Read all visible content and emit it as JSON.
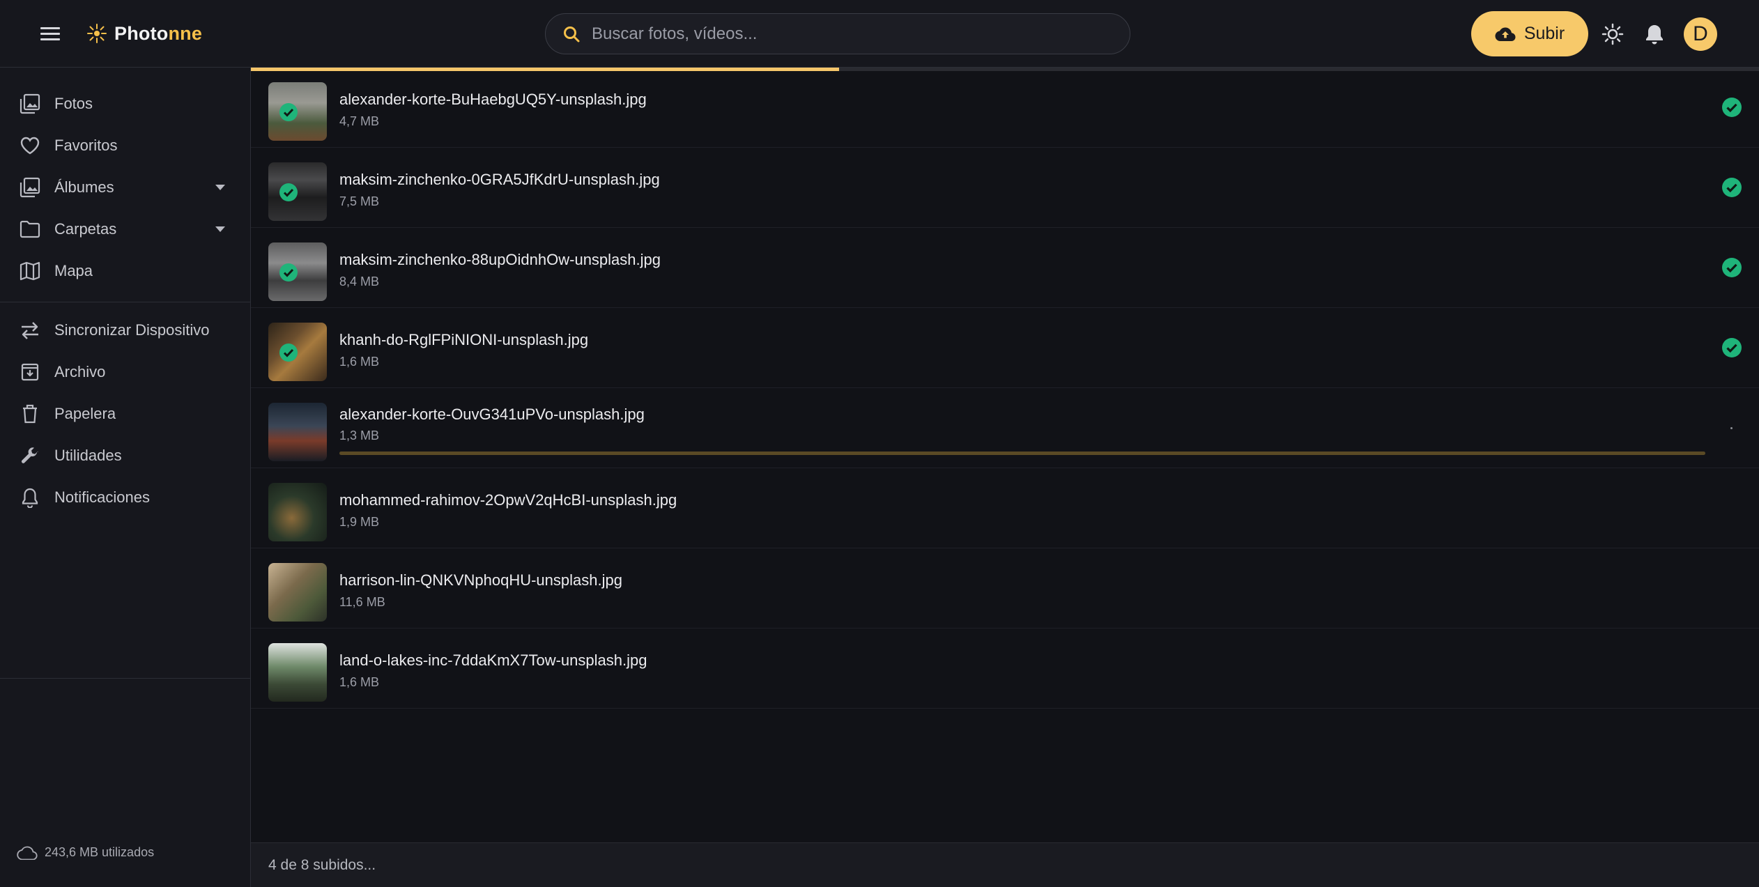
{
  "header": {
    "app_name_part1": "Photo",
    "app_name_part2": "nne",
    "search_placeholder": "Buscar fotos, vídeos...",
    "upload_label": "Subir",
    "avatar_initial": "D",
    "accent_color": "#f7c96a"
  },
  "sidebar": {
    "items": [
      {
        "label": "Fotos",
        "icon": "photos-icon"
      },
      {
        "label": "Favoritos",
        "icon": "heart-icon"
      },
      {
        "label": "Álbumes",
        "icon": "albums-icon",
        "expandable": true
      },
      {
        "label": "Carpetas",
        "icon": "folder-icon",
        "expandable": true
      },
      {
        "label": "Mapa",
        "icon": "map-icon"
      },
      {
        "label": "Sincronizar Dispositivo",
        "icon": "sync-icon"
      },
      {
        "label": "Archivo",
        "icon": "archive-icon"
      },
      {
        "label": "Papelera",
        "icon": "trash-icon"
      },
      {
        "label": "Utilidades",
        "icon": "wrench-icon"
      },
      {
        "label": "Notificaciones",
        "icon": "bell-icon"
      }
    ],
    "storage_used": "243,6 MB utilizados"
  },
  "upload": {
    "overall_progress": 0.39,
    "files": [
      {
        "name": "alexander-korte-BuHaebgUQ5Y-unsplash.jpg",
        "size": "4,7 MB",
        "status": "done"
      },
      {
        "name": "maksim-zinchenko-0GRA5JfKdrU-unsplash.jpg",
        "size": "7,5 MB",
        "status": "done"
      },
      {
        "name": "maksim-zinchenko-88upOidnhOw-unsplash.jpg",
        "size": "8,4 MB",
        "status": "done"
      },
      {
        "name": "khanh-do-RglFPiNIONI-unsplash.jpg",
        "size": "1,6 MB",
        "status": "done"
      },
      {
        "name": "alexander-korte-OuvG341uPVo-unsplash.jpg",
        "size": "1,3 MB",
        "status": "uploading",
        "progress": 1.0
      },
      {
        "name": "mohammed-rahimov-2OpwV2qHcBI-unsplash.jpg",
        "size": "1,9 MB",
        "status": "pending"
      },
      {
        "name": "harrison-lin-QNKVNphoqHU-unsplash.jpg",
        "size": "11,6 MB",
        "status": "pending"
      },
      {
        "name": "land-o-lakes-inc-7ddaKmX7Tow-unsplash.jpg",
        "size": "1,6 MB",
        "status": "pending"
      }
    ],
    "status_text": "4 de 8 subidos...",
    "success_color": "#1fb47a"
  }
}
